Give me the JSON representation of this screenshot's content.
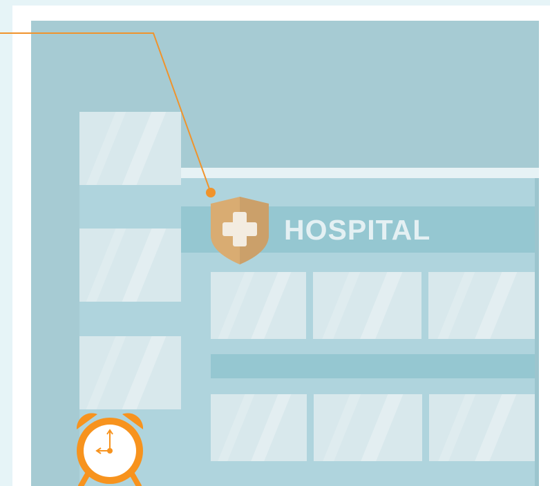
{
  "sign": {
    "text": "HOSPITAL"
  },
  "colors": {
    "background": "#e6f4f7",
    "panel": "#a6cbd3",
    "building": "#afd4dd",
    "sign_band": "#95c7d1",
    "window": "#d8e8ec",
    "shield": "#d9ac72",
    "leader_line": "#f0932b",
    "clock": "#f7931e"
  },
  "icons": {
    "shield": "medical-cross-shield-icon",
    "clock": "alarm-clock-icon"
  }
}
